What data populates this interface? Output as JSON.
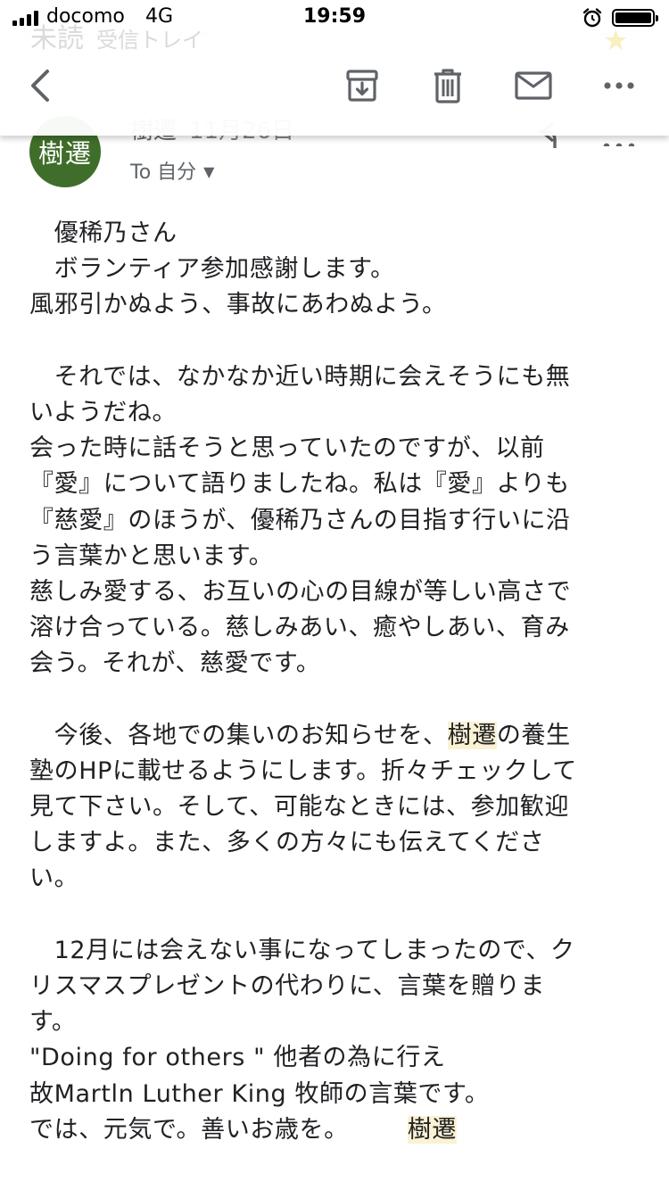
{
  "status_bar": {
    "carrier": "docomo",
    "network": "4G",
    "time": "19:59"
  },
  "header": {
    "background_title": "未読",
    "background_subtitle": "受信トレイ"
  },
  "sender": {
    "avatar_text": "樹遷",
    "name": "樹遷",
    "date": "11月26日",
    "to_label": "To 自分"
  },
  "body": {
    "p1": [
      "　優稀乃さん",
      "　ボランティア参加感謝します。",
      "風邪引かぬよう、事故にあわぬよう。"
    ],
    "p2": [
      "　それでは、なかなか近い時期に会えそうにも無",
      "いようだね。",
      "会った時に話そうと思っていたのですが、以前",
      "『愛』について語りましたね。私は『愛』よりも",
      "『慈愛』のほうが、優稀乃さんの目指す行いに沿",
      "う言葉かと思います。",
      "慈しみ愛する、お互いの心の目線が等しい高さで",
      "溶け合っている。慈しみあい、癒やしあい、育み",
      "会う。それが、慈愛です。"
    ],
    "p3_line1_before": "　今後、各地での集いのお知らせを、",
    "p3_line1_highlight": "樹遷",
    "p3_line1_after": "の養生",
    "p3_rest": [
      "塾のHPに載せるようにします。折々チェックして",
      "見て下さい。そして、可能なときには、参加歓迎",
      "しますよ。また、多くの方々にも伝えてくださ",
      "い。"
    ],
    "p4": [
      "　12月には会えない事になってしまったので、ク",
      "リスマスプレゼントの代わりに、言葉を贈りま",
      "す。",
      "\"Doing for  others \"  他者の為に行え",
      "故Martln  Luther  King 牧師の言葉です。"
    ],
    "closing_text": "では、元気で。善いお歳を。",
    "closing_signature": "樹遷"
  },
  "colors": {
    "avatar_bg": "#3f6e2a",
    "highlight": "#fbf2d3",
    "icon": "#5f6368"
  }
}
